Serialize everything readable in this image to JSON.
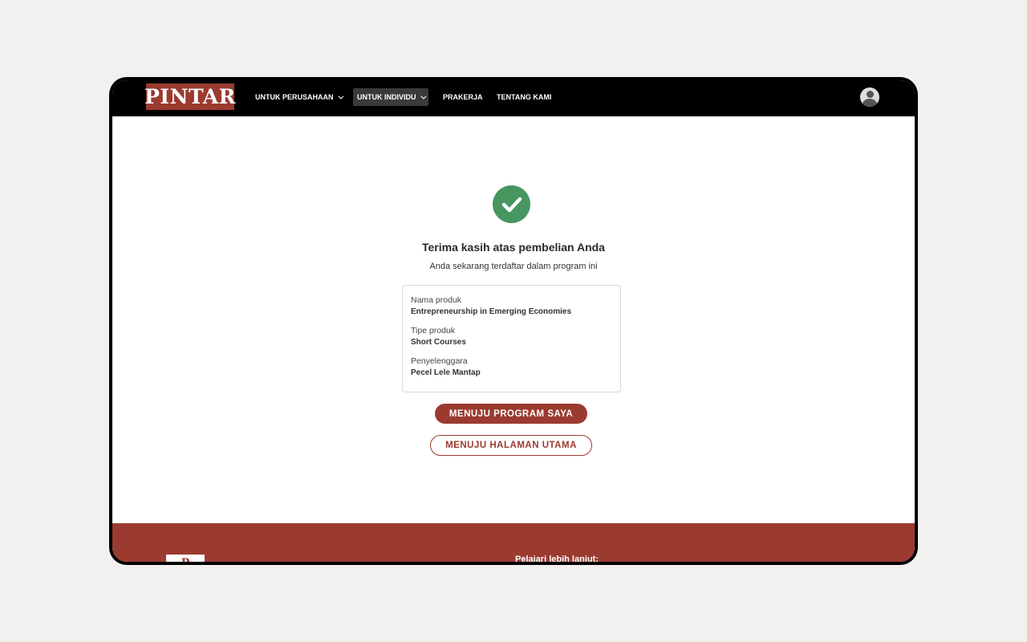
{
  "navbar": {
    "logo_text": "PINTAR",
    "items": [
      {
        "label": "UNTUK PERUSAHAAN",
        "has_dropdown": true,
        "active": false
      },
      {
        "label": "UNTUK INDIVIDU",
        "has_dropdown": true,
        "active": true
      },
      {
        "label": "PRAKERJA",
        "has_dropdown": false,
        "active": false
      },
      {
        "label": "TENTANG KAMI",
        "has_dropdown": false,
        "active": false
      }
    ],
    "avatar_icon": "user-avatar-icon"
  },
  "main": {
    "status_icon": "check-circle-icon",
    "title": "Terima kasih atas pembelian Anda",
    "subtitle": "Anda sekarang terdaftar dalam program ini",
    "details": [
      {
        "label": "Nama produk",
        "value": "Entrepreneurship in Emerging Economies"
      },
      {
        "label": "Tipe produk",
        "value": "Short Courses"
      },
      {
        "label": "Penyelenggara",
        "value": "Pecel Lele Mantap"
      }
    ],
    "primary_button": "MENUJU PROGRAM SAYA",
    "secondary_button": "MENUJU HALAMAN UTAMA"
  },
  "footer": {
    "logo_text": "P",
    "heading": "Pelajari lebih lanjut:"
  },
  "colors": {
    "brand": "#9b3a2f",
    "success": "#479660",
    "navbar_bg": "#000000",
    "page_bg": "#f2f1ef"
  }
}
